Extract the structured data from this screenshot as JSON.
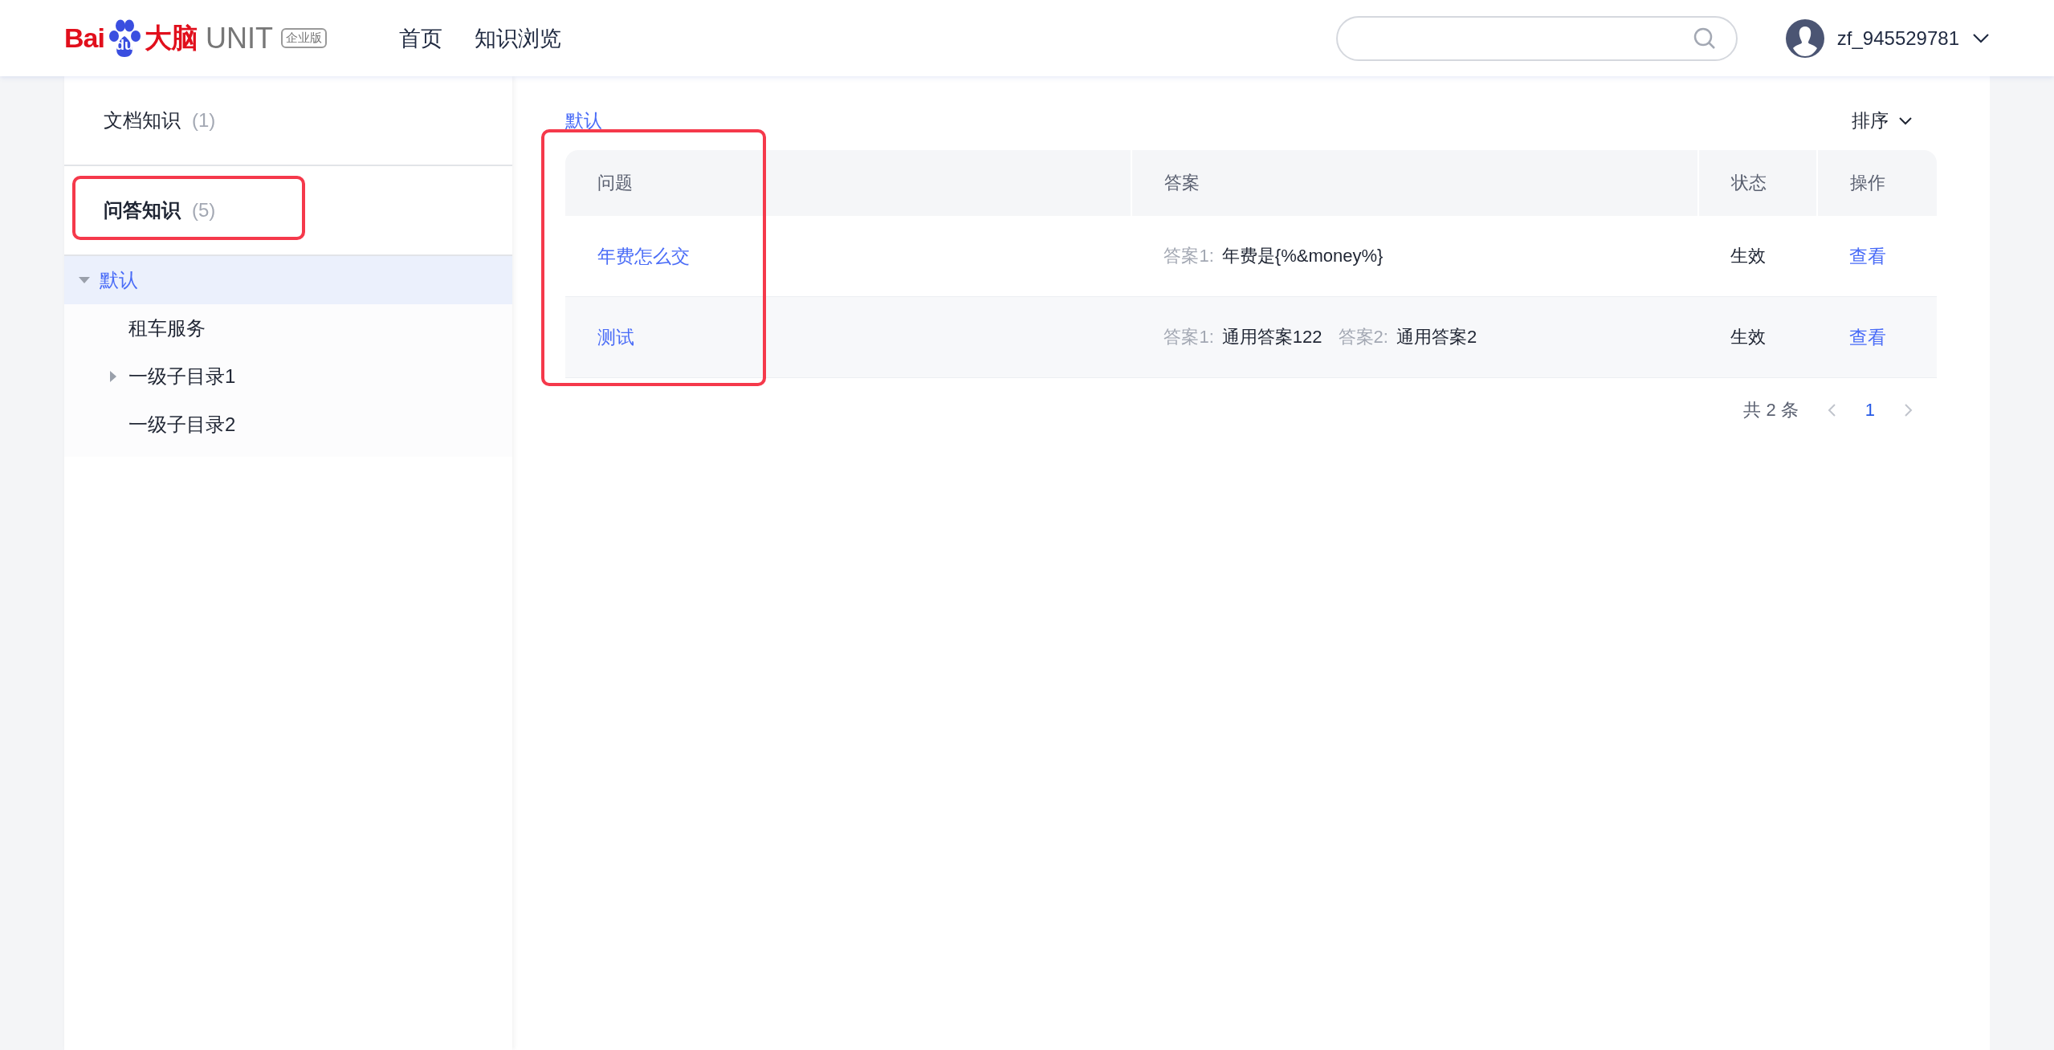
{
  "header": {
    "logo": {
      "brand_left": "Bai",
      "brand_paw": "du",
      "brand_right": "大脑",
      "product": "UNIT",
      "edition": "企业版"
    },
    "nav": [
      "首页",
      "知识浏览"
    ],
    "user": {
      "name": "zf_945529781"
    }
  },
  "sidebar": {
    "sections": [
      {
        "label": "文档知识",
        "count": "(1)",
        "selected": false,
        "highlighted": false
      },
      {
        "label": "问答知识",
        "count": "(5)",
        "selected": true,
        "highlighted": true
      }
    ],
    "tree": [
      {
        "label": "默认",
        "selected": true,
        "expanded": true,
        "children": [
          {
            "label": "租车服务",
            "selected": false
          },
          {
            "label": "一级子目录1",
            "selected": false,
            "expanded": false
          },
          {
            "label": "一级子目录2",
            "selected": false
          }
        ]
      }
    ]
  },
  "main": {
    "breadcrumb": "默认",
    "sort": "排序",
    "table": {
      "columns": [
        {
          "label": "问题",
          "highlighted": true
        },
        {
          "label": "答案",
          "highlighted": false
        },
        {
          "label": "状态",
          "highlighted": false
        },
        {
          "label": "操作",
          "highlighted": false
        }
      ],
      "rows": [
        {
          "question": "年费怎么交",
          "answers": [
            {
              "label": "答案1:",
              "text": "年费是{%&money%}"
            }
          ],
          "status": "生效",
          "action": "查看"
        },
        {
          "question": "测试",
          "answers": [
            {
              "label": "答案1:",
              "text": "通用答案122"
            },
            {
              "label": "答案2:",
              "text": "通用答案2"
            }
          ],
          "status": "生效",
          "action": "查看"
        }
      ]
    },
    "pagination": {
      "total": "共 2 条",
      "pages": [
        {
          "label": "1",
          "selected": true
        }
      ]
    }
  }
}
